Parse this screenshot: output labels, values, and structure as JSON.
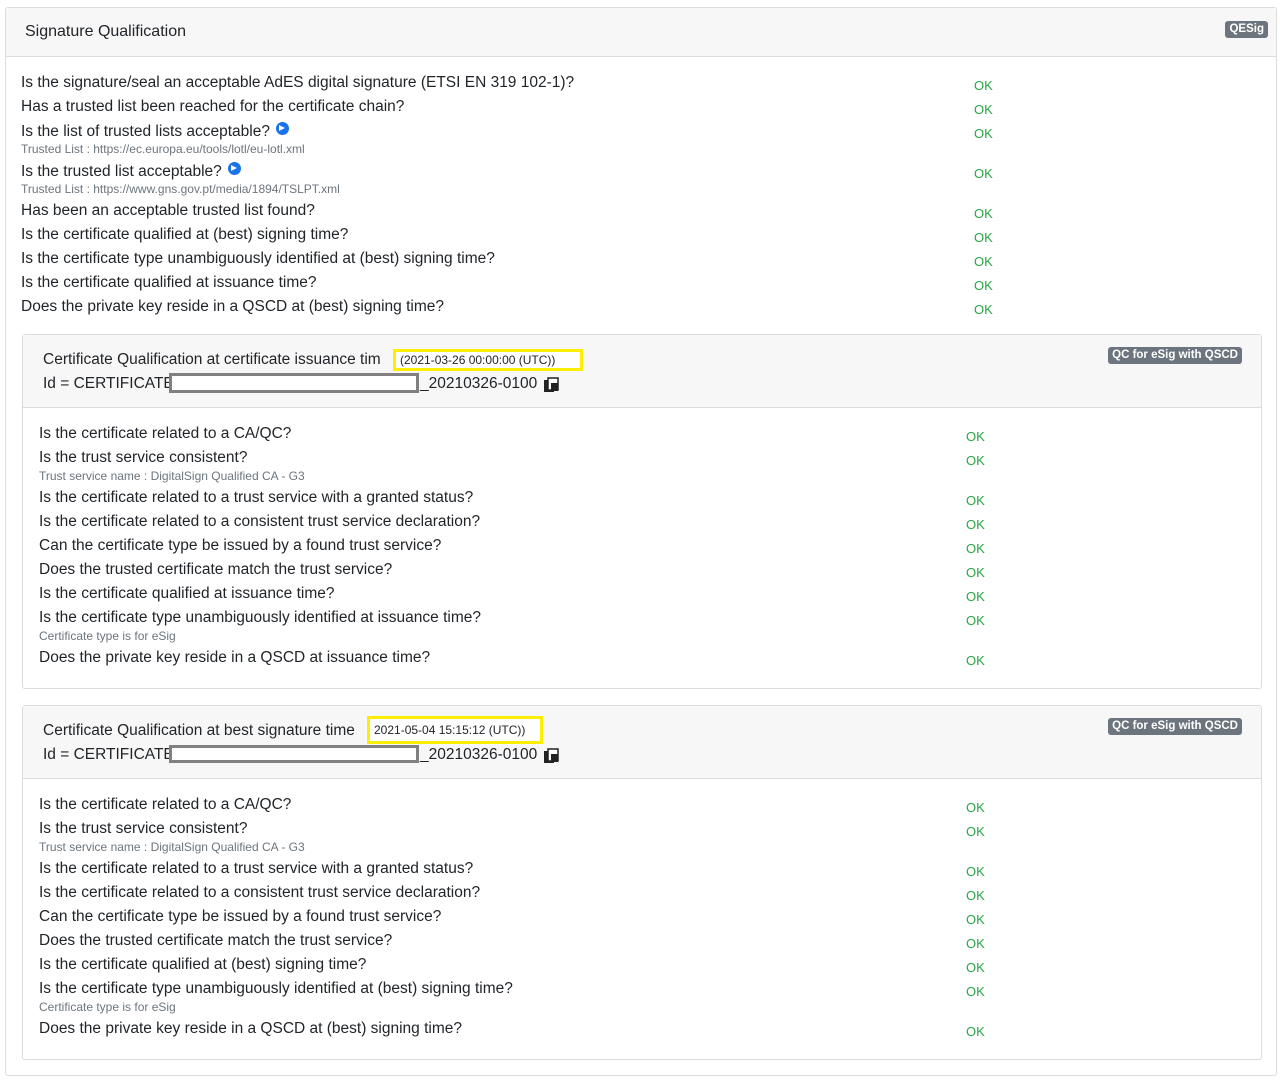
{
  "header": {
    "title": "Signature Qualification",
    "badge": "QESig"
  },
  "checks": [
    {
      "q": "Is the signature/seal an acceptable AdES digital signature (ETSI EN 319 102-1)?",
      "r": "OK"
    },
    {
      "q": "Has a trusted list been reached for the certificate chain?",
      "r": "OK"
    },
    {
      "q": "Is the list of trusted lists acceptable?",
      "r": "OK",
      "sub": "Trusted List : https://ec.europa.eu/tools/lotl/eu-lotl.xml"
    },
    {
      "q": "Is the trusted list acceptable?",
      "r": "OK",
      "sub": "Trusted List : https://www.gns.gov.pt/media/1894/TSLPT.xml"
    },
    {
      "q": "Has been an acceptable trusted list found?",
      "r": "OK"
    },
    {
      "q": "Is the certificate qualified at (best) signing time?",
      "r": "OK"
    },
    {
      "q": "Is the certificate type unambiguously identified at (best) signing time?",
      "r": "OK"
    },
    {
      "q": "Is the certificate qualified at issuance time?",
      "r": "OK"
    },
    {
      "q": "Does the private key reside in a QSCD at (best) signing time?",
      "r": "OK"
    }
  ],
  "issuance": {
    "title": "Certificate Qualification at certificate issuance tim",
    "time": "(2021-03-26 00:00:00 (UTC))",
    "id_prefix": "Id = CERTIFICATE_",
    "id_suffix": "_20210326-0100",
    "badge": "QC for eSig with QSCD",
    "checks": [
      {
        "q": "Is the certificate related to a CA/QC?",
        "r": "OK"
      },
      {
        "q": "Is the trust service consistent?",
        "r": "OK",
        "sub": "Trust service name : DigitalSign Qualified CA - G3"
      },
      {
        "q": "Is the certificate related to a trust service with a granted status?",
        "r": "OK"
      },
      {
        "q": "Is the certificate related to a consistent trust service declaration?",
        "r": "OK"
      },
      {
        "q": "Can the certificate type be issued by a found trust service?",
        "r": "OK"
      },
      {
        "q": "Does the trusted certificate match the trust service?",
        "r": "OK"
      },
      {
        "q": "Is the certificate qualified at issuance time?",
        "r": "OK"
      },
      {
        "q": "Is the certificate type unambiguously identified at issuance time?",
        "r": "OK",
        "sub": "Certificate type is for eSig"
      },
      {
        "q": "Does the private key reside in a QSCD at issuance time?",
        "r": "OK"
      }
    ]
  },
  "best": {
    "title": "Certificate Qualification at best signature time",
    "time": "2021-05-04 15:15:12 (UTC))",
    "id_prefix": "Id = CERTIFICATE_",
    "id_suffix": "_20210326-0100",
    "badge": "QC for eSig with QSCD",
    "checks": [
      {
        "q": "Is the certificate related to a CA/QC?",
        "r": "OK"
      },
      {
        "q": "Is the trust service consistent?",
        "r": "OK",
        "sub": "Trust service name : DigitalSign Qualified CA - G3"
      },
      {
        "q": "Is the certificate related to a trust service with a granted status?",
        "r": "OK"
      },
      {
        "q": "Is the certificate related to a consistent trust service declaration?",
        "r": "OK"
      },
      {
        "q": "Can the certificate type be issued by a found trust service?",
        "r": "OK"
      },
      {
        "q": "Does the trusted certificate match the trust service?",
        "r": "OK"
      },
      {
        "q": "Is the certificate qualified at (best) signing time?",
        "r": "OK"
      },
      {
        "q": "Is the certificate type unambiguously identified at (best) signing time?",
        "r": "OK",
        "sub": "Certificate type is for eSig"
      },
      {
        "q": "Does the private key reside in a QSCD at (best) signing time?",
        "r": "OK"
      }
    ]
  }
}
